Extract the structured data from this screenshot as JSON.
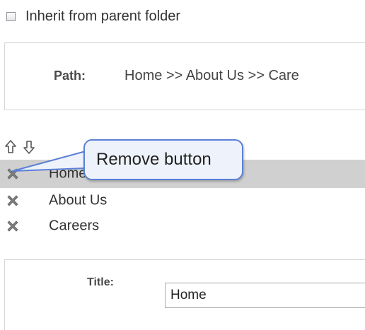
{
  "inherit": {
    "label": "Inherit from parent folder",
    "checked": false
  },
  "path": {
    "label": "Path:",
    "value": "Home >> About Us >> Care"
  },
  "order_controls": {
    "up_icon": "arrow-up-icon",
    "down_icon": "arrow-down-icon"
  },
  "callout": {
    "text": "Remove button"
  },
  "items": [
    {
      "label": "Home",
      "selected": true,
      "icon": "remove-x-icon"
    },
    {
      "label": "About Us",
      "selected": false,
      "icon": "remove-x-icon"
    },
    {
      "label": "Careers",
      "selected": false,
      "icon": "remove-x-icon"
    }
  ],
  "title_field": {
    "label": "Title:",
    "value": "Home"
  },
  "colors": {
    "selected_row": "#d0d0d0",
    "callout_border": "#5b80d6",
    "callout_fill": "#eef2fb",
    "icon_gray": "#7a7a7a"
  }
}
